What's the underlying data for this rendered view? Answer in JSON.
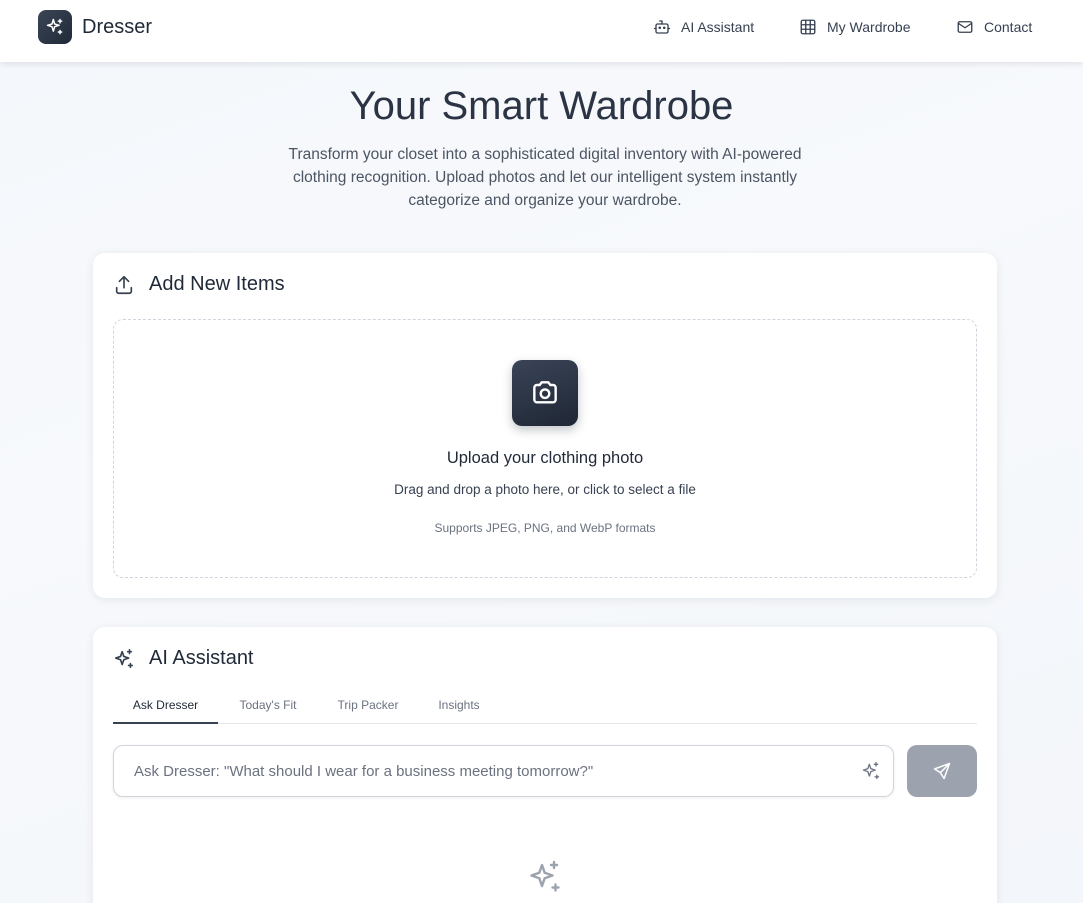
{
  "brand": {
    "name": "Dresser"
  },
  "nav": {
    "items": [
      {
        "label": "AI Assistant"
      },
      {
        "label": "My Wardrobe"
      },
      {
        "label": "Contact"
      }
    ]
  },
  "hero": {
    "title": "Your Smart Wardrobe",
    "subtitle": "Transform your closet into a sophisticated digital inventory with AI-powered clothing recognition. Upload photos and let our intelligent system instantly categorize and organize your wardrobe."
  },
  "upload": {
    "title": "Add New Items",
    "dropzone_title": "Upload your clothing photo",
    "dropzone_desc": "Drag and drop a photo here, or click to select a file",
    "dropzone_note": "Supports JPEG, PNG, and WebP formats"
  },
  "assistant": {
    "title": "AI Assistant",
    "tabs": [
      {
        "label": "Ask Dresser",
        "active": true
      },
      {
        "label": "Today's Fit",
        "active": false
      },
      {
        "label": "Trip Packer",
        "active": false
      },
      {
        "label": "Insights",
        "active": false
      }
    ],
    "input_placeholder": "Ask Dresser: \"What should I wear for a business meeting tomorrow?\"",
    "input_value": ""
  },
  "colors": {
    "accent_dark": "#1f2937",
    "send_disabled": "#9ca3af",
    "background": "#f4f7fb"
  },
  "icons": {
    "brand": "sparkles-icon",
    "nav_assistant": "robot-icon",
    "nav_wardrobe": "grid-icon",
    "nav_contact": "mail-icon",
    "upload": "upload-icon",
    "camera": "camera-icon",
    "assistant": "sparkles-icon",
    "send": "send-icon"
  }
}
